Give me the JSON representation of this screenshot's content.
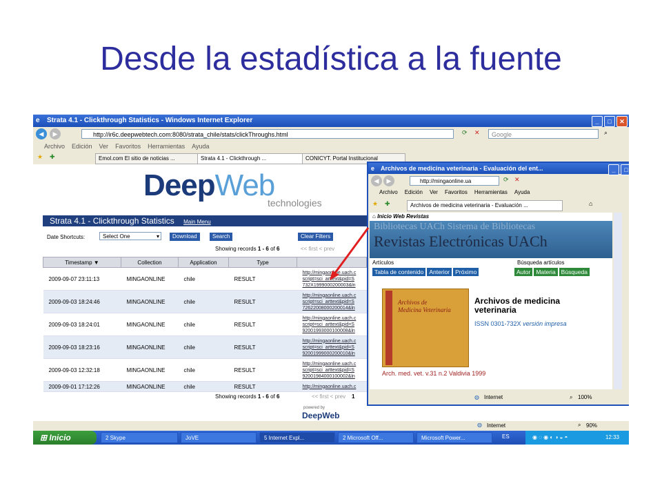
{
  "slide": {
    "title": "Desde la estadística a la fuente"
  },
  "main_window": {
    "title": "Strata 4.1 - Clickthrough Statistics - Windows Internet Explorer",
    "url": "http://ir6c.deepwebtech.com:8080/strata_chile/stats/clickThroughs.html",
    "search_placeholder": "Google",
    "menu": [
      "Archivo",
      "Edición",
      "Ver",
      "Favoritos",
      "Herramientas",
      "Ayuda"
    ],
    "tabs": [
      "Emol.com El sitio de noticias ...",
      "Strata 4.1 - Clickthrough ...",
      "CONICYT. Portal Institucional"
    ],
    "status_zone": "Internet",
    "zoom": "90%"
  },
  "page": {
    "logo_deep": "Deep",
    "logo_web": "Web",
    "logo_sub": "technologies",
    "header_title": "Strata 4.1 - Clickthrough Statistics",
    "main_menu": "Main Menu",
    "date_shortcuts_label": "Date Shortcuts:",
    "date_select": "Select One",
    "download": "Download",
    "search": "Search",
    "clear_filters": "Clear Filters",
    "showing_prefix": "Showing records",
    "showing_range": "1 - 6",
    "showing_of": "of",
    "showing_total": "6",
    "pager": "<< first  < prev",
    "pager_page": "1",
    "columns": [
      "Timestamp ▼",
      "Collection",
      "Application",
      "Type"
    ],
    "rows": [
      {
        "ts": "2009-09-07 23:11:13",
        "col": "MINGAONLINE",
        "app": "chile",
        "type": "RESULT",
        "url1": "http://mingaonline.uach.c",
        "url2": "script=sci_arttext&pid=S",
        "url3": "732X1999000200003&ln"
      },
      {
        "ts": "2009-09-03 18:24:46",
        "col": "MINGAONLINE",
        "app": "chile",
        "type": "RESULT",
        "url1": "http://mingaonline.uach.c",
        "url2": "script=sci_arttext&pid=S",
        "url3": "72622008000200014&ln"
      },
      {
        "ts": "2009-09-03 18:24:01",
        "col": "MINGAONLINE",
        "app": "chile",
        "type": "RESULT",
        "url1": "http://mingaonline.uach.c",
        "url2": "script=sci_arttext&pid=S",
        "url3": "92001993000100008&ln"
      },
      {
        "ts": "2009-09-03 18:23:16",
        "col": "MINGAONLINE",
        "app": "chile",
        "type": "RESULT",
        "url1": "http://mingaonline.uach.c",
        "url2": "script=sci_arttext&pid=S",
        "url3": "92001999000200010&ln"
      },
      {
        "ts": "2009-09-03 12:32:18",
        "col": "MINGAONLINE",
        "app": "chile",
        "type": "RESULT",
        "url1": "http://mingaonline.uach.c",
        "url2": "script=sci_arttext&pid=S",
        "url3": "92001984000100002&ln"
      },
      {
        "ts": "2009-09-01 17:12:26",
        "col": "MINGAONLINE",
        "app": "chile",
        "type": "RESULT",
        "url1": "http://mingaonline.uach.c",
        "url2": "",
        "url3": ""
      }
    ],
    "powered_by": "powered by",
    "powered_logo": "DeepWeb"
  },
  "popup": {
    "title": "Archivos de medicina veterinaria - Evaluación del ent...",
    "url": "http://mingaonline.ua",
    "menu": [
      "Archivo",
      "Edición",
      "Ver",
      "Favoritos",
      "Herramientas",
      "Ayuda"
    ],
    "tab": "Archivos de medicina veterinaria - Evaluación ...",
    "breadcrumb": "Inicio Web Revistas",
    "banner_top": "Bibliotecas UACh   Sistema de Bibliotecas",
    "banner_main": "Revistas Electrónicas UACh",
    "articulos": "Artículos",
    "busqueda": "Búsqueda artículos",
    "btn_toc": "Tabla de contenido",
    "btn_prev": "Anterior",
    "btn_next": "Próximo",
    "btn_autor": "Autor",
    "btn_materia": "Materia",
    "btn_busqueda": "Búsqueda",
    "cover_title_1": "Archivos de",
    "cover_title_2": "Medicina Veterinaria",
    "journal_title_1": "Archivos de medicina",
    "journal_title_2": "veterinaria",
    "issn": "ISSN 0301-732X",
    "issn_version": "versión impresa",
    "citation": "Arch. med. vet. v.31 n.2 Valdivia 1999",
    "status_zone": "Internet",
    "zoom": "100%"
  },
  "taskbar": {
    "start": "Inicio",
    "items": [
      "2 Skype",
      "JoVE",
      "5 Internet Expl...",
      "2 Microsoft Off...",
      "Microsoft Power..."
    ],
    "lang": "ES",
    "clock": "12:33"
  }
}
